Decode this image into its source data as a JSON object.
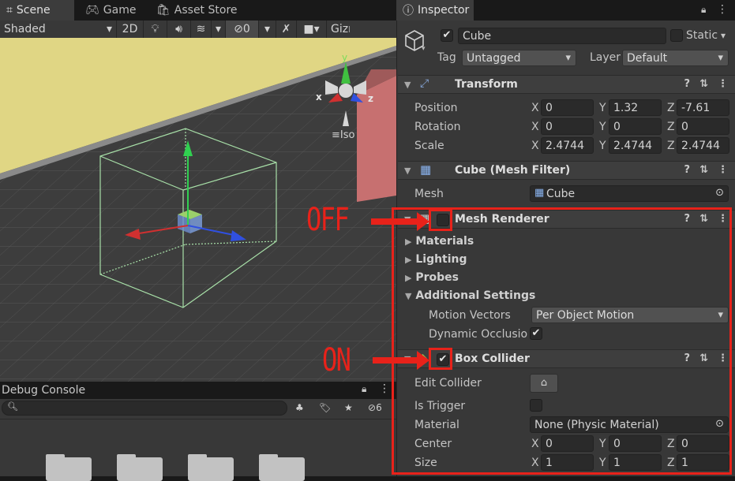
{
  "tabs": {
    "scene": "Scene",
    "game": "Game",
    "asset_store": "Asset Store",
    "inspector": "Inspector",
    "more": "⋮"
  },
  "toolbar": {
    "shading": "Shaded",
    "mode_2d": "2D",
    "hidden_count": "0",
    "gizmos": "Gizmos"
  },
  "scene": {
    "iso_label": "Iso",
    "axis_x": "x",
    "axis_y": "y",
    "axis_z": "z"
  },
  "console": {
    "title": "Debug Console",
    "search_placeholder": "",
    "hidden_count": "6"
  },
  "object": {
    "name": "Cube",
    "static_label": "Static",
    "tag_label": "Tag",
    "tag_value": "Untagged",
    "layer_label": "Layer",
    "layer_value": "Default"
  },
  "transform": {
    "title": "Transform",
    "position_label": "Position",
    "rotation_label": "Rotation",
    "scale_label": "Scale",
    "position": {
      "x": "0",
      "y": "1.32",
      "z": "-7.61"
    },
    "rotation": {
      "x": "0",
      "y": "0",
      "z": "0"
    },
    "scale": {
      "x": "2.4744",
      "y": "2.4744",
      "z": "2.4744"
    },
    "x": "X",
    "y": "Y",
    "z": "Z"
  },
  "mesh_filter": {
    "title": "Cube (Mesh Filter)",
    "mesh_label": "Mesh",
    "mesh_value": "Cube"
  },
  "mesh_renderer": {
    "title": "Mesh Renderer",
    "enabled": false,
    "materials": "Materials",
    "lighting": "Lighting",
    "probes": "Probes",
    "additional": "Additional Settings",
    "motion_vectors_label": "Motion Vectors",
    "motion_vectors_value": "Per Object Motion",
    "dynamic_occlusion_label": "Dynamic Occlusion",
    "dynamic_occlusion": true
  },
  "box_collider": {
    "title": "Box Collider",
    "enabled": true,
    "edit_collider_label": "Edit Collider",
    "is_trigger_label": "Is Trigger",
    "material_label": "Material",
    "material_value": "None (Physic Material)",
    "center_label": "Center",
    "size_label": "Size",
    "center": {
      "x": "0",
      "y": "0",
      "z": "0"
    },
    "size": {
      "x": "1",
      "y": "1",
      "z": "1"
    }
  },
  "annotations": {
    "off": "OFF",
    "on": "ON"
  },
  "colors": {
    "annotation_red": "#e8221a",
    "panel": "#383838",
    "field": "#2a2a2a"
  }
}
